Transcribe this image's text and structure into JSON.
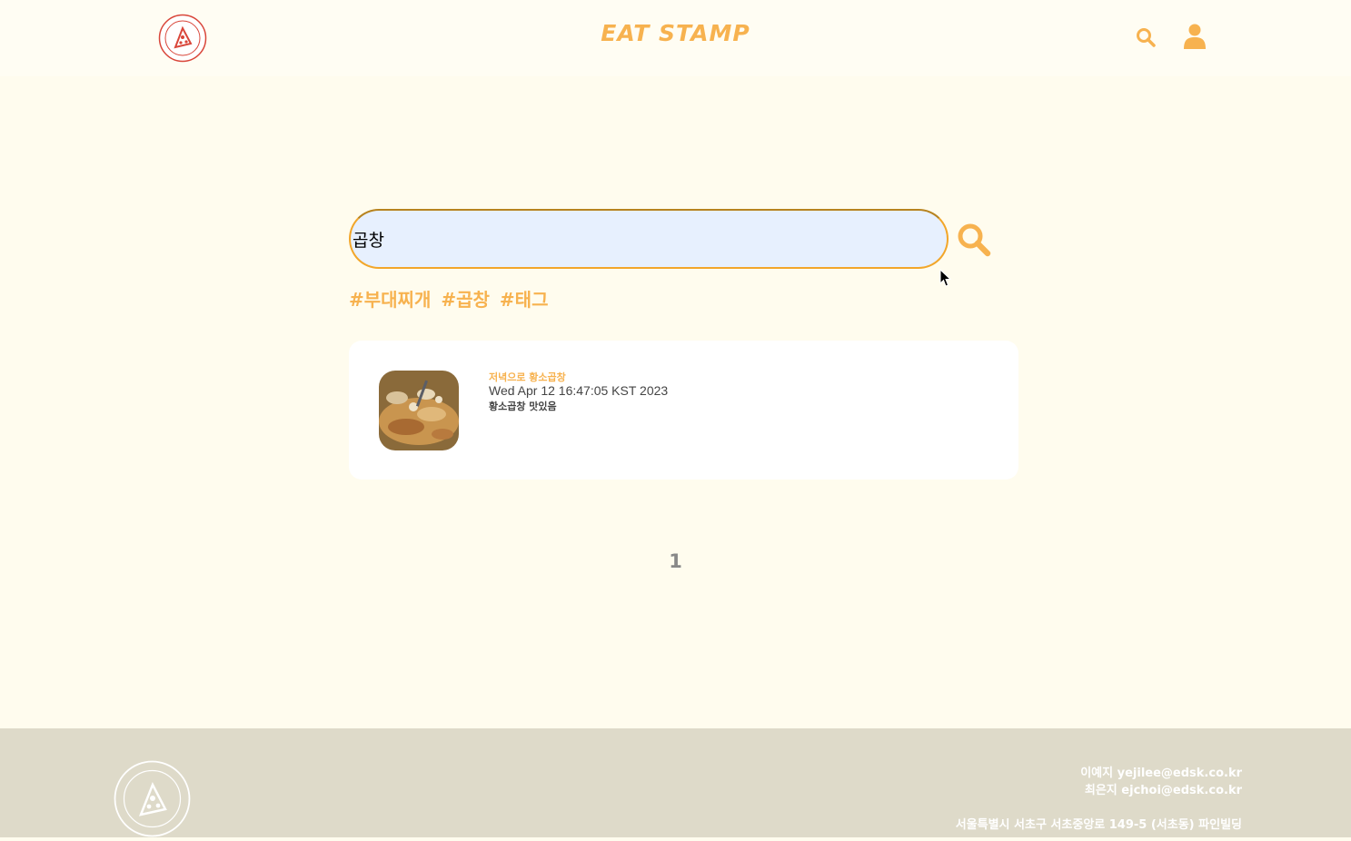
{
  "header": {
    "brand": "EAT STAMP",
    "logo_icon": "pizza-stamp-logo",
    "search_icon": "search-icon",
    "user_icon": "user-icon",
    "accent_color": "#f7b24f"
  },
  "search": {
    "value": "곱창",
    "button_icon": "search-icon"
  },
  "tags": [
    "#부대찌개",
    "#곱창",
    "#태그"
  ],
  "results": [
    {
      "title": "저녁으로 황소곱창",
      "date": "Wed Apr 12 16:47:05 KST 2023",
      "body": "황소곱창 맛있음"
    }
  ],
  "pagination": {
    "current": "1"
  },
  "footer": {
    "contact1": "이예지 yejilee@edsk.co.kr",
    "contact2": "최은지 ejchoi@edsk.co.kr",
    "address": "서울특별시 서초구 서초중앙로 149-5 (서초동) 파인빌딩"
  }
}
